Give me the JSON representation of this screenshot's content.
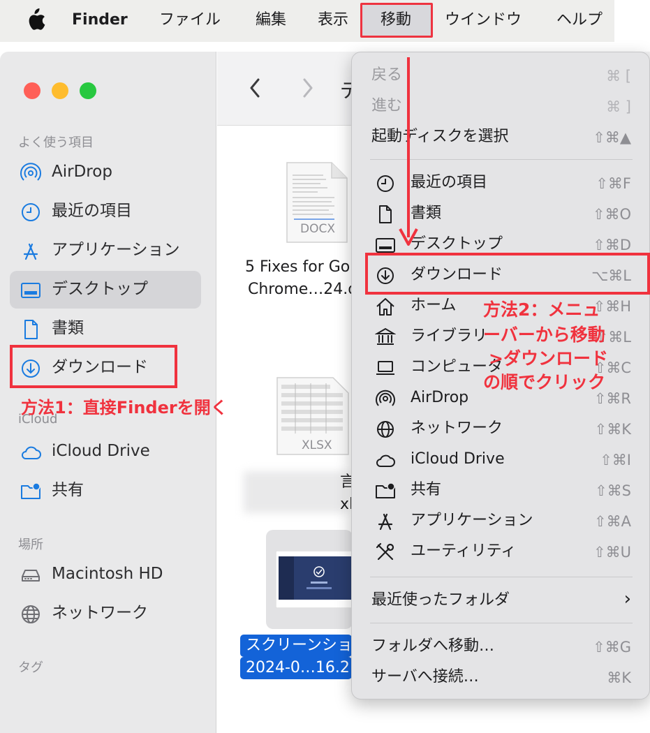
{
  "menubar": {
    "items": [
      "Finder",
      "ファイル",
      "編集",
      "表示",
      "移動",
      "ウインドウ",
      "ヘルプ"
    ]
  },
  "sidebar": {
    "sections": {
      "favorites": "よく使う項目",
      "icloud": "iCloud",
      "locations": "場所",
      "tags": "タグ"
    },
    "items": [
      {
        "label": "AirDrop",
        "icon": "airdrop-icon"
      },
      {
        "label": "最近の項目",
        "icon": "clock-icon"
      },
      {
        "label": "アプリケーション",
        "icon": "applications-icon"
      },
      {
        "label": "デスクトップ",
        "icon": "desktop-icon"
      },
      {
        "label": "書類",
        "icon": "document-icon"
      },
      {
        "label": "ダウンロード",
        "icon": "download-icon"
      },
      {
        "label": "iCloud Drive",
        "icon": "cloud-icon"
      },
      {
        "label": "共有",
        "icon": "shared-folder-icon"
      },
      {
        "label": "Macintosh HD",
        "icon": "disk-icon"
      },
      {
        "label": "ネットワーク",
        "icon": "globe-icon"
      }
    ]
  },
  "toolbar": {
    "title_fragment": "デ"
  },
  "files": [
    {
      "badge": "DOCX",
      "line1": "5 Fixes for Go",
      "line2": "Chrome…24.d"
    },
    {
      "badge": "XLSX",
      "line1": "言",
      "line2": "xls"
    },
    {
      "line1": "スクリーンショ",
      "line2": "2024-0…16.2"
    }
  ],
  "menu": {
    "items": [
      {
        "label": "戻る",
        "shortcut": "⌘ [",
        "disabled": true
      },
      {
        "label": "進む",
        "shortcut": "⌘ ]",
        "disabled": true
      },
      {
        "label": "起動ディスクを選択",
        "shortcut": "⇧⌘▲"
      },
      {
        "label": "最近の項目",
        "shortcut": "⇧⌘F",
        "icon": "clock-icon"
      },
      {
        "label": "書類",
        "shortcut": "⇧⌘O",
        "icon": "document-icon"
      },
      {
        "label": "デスクトップ",
        "shortcut": "⇧⌘D",
        "icon": "desktop-icon"
      },
      {
        "label": "ダウンロード",
        "shortcut": "⌥⌘L",
        "icon": "download-icon"
      },
      {
        "label": "ホーム",
        "shortcut": "⇧⌘H",
        "icon": "home-icon"
      },
      {
        "label": "ライブラリ",
        "shortcut": "⇧⌘L",
        "icon": "library-icon"
      },
      {
        "label": "コンピュータ",
        "shortcut": "⇧⌘C",
        "icon": "computer-icon"
      },
      {
        "label": "AirDrop",
        "shortcut": "⇧⌘R",
        "icon": "airdrop-icon"
      },
      {
        "label": "ネットワーク",
        "shortcut": "⇧⌘K",
        "icon": "globe-icon"
      },
      {
        "label": "iCloud Drive",
        "shortcut": "⇧⌘I",
        "icon": "cloud-icon"
      },
      {
        "label": "共有",
        "shortcut": "⇧⌘S",
        "icon": "shared-folder-icon"
      },
      {
        "label": "アプリケーション",
        "shortcut": "⇧⌘A",
        "icon": "applications-icon"
      },
      {
        "label": "ユーティリティ",
        "shortcut": "⇧⌘U",
        "icon": "utilities-icon"
      },
      {
        "label": "最近使ったフォルダ",
        "shortcut": "›"
      },
      {
        "label": "フォルダへ移動…",
        "shortcut": "⇧⌘G"
      },
      {
        "label": "サーバへ接続…",
        "shortcut": "⌘K"
      }
    ]
  },
  "annotations": {
    "method1": "方法1：直接Finderを開く",
    "method2": [
      "方法2：メニュ",
      "ーバーから移動",
      ">ダウンロード",
      "の順でクリック"
    ]
  },
  "colors": {
    "annotation": "#f0323e",
    "selection": "#1363d8",
    "accent": "#1a7be0"
  }
}
